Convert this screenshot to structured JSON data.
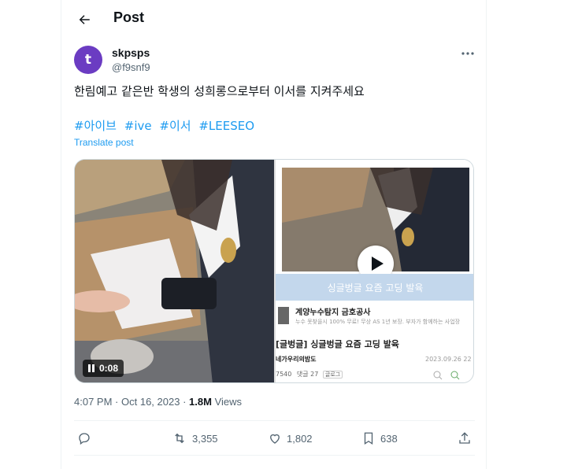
{
  "header": {
    "title": "Post"
  },
  "author": {
    "avatar_letter": "t",
    "display_name": "skpsps",
    "handle": "@f9snf9"
  },
  "tweet": {
    "text": "한림예고 같은반 학생의 성희롱으로부터 이서를 지켜주세요",
    "hashtags": [
      "#아이브",
      "#ive",
      "#이서",
      "#LEESEO"
    ],
    "translate_label": "Translate post"
  },
  "media": {
    "video_duration": "0:08",
    "blog": {
      "header_title": "싱글벙글 요즘 고딩 발육",
      "ad_title": "계양누수탐지 금호공사",
      "ad_sub": "누수 못찾을시 100% 무료! 무상 AS 1년 보장. 부자가 함께하는 사업장",
      "post_title": "[글벙글] 싱글벙글 요즘 고딩 발육",
      "blog_name": "네가우리의밤도",
      "date": "2023.09.26 22",
      "meta_views": "7540",
      "meta_comments": "댓글 27",
      "meta_button": "글로그"
    }
  },
  "meta": {
    "time": "4:07 PM",
    "date": "Oct 16, 2023",
    "views_count": "1.8M",
    "views_label": "Views"
  },
  "actions": {
    "retweets": "3,355",
    "likes": "1,802",
    "bookmarks": "638"
  },
  "colors": {
    "accent": "#1d9bf0",
    "avatar": "#6b3cc2",
    "muted": "#536471"
  }
}
